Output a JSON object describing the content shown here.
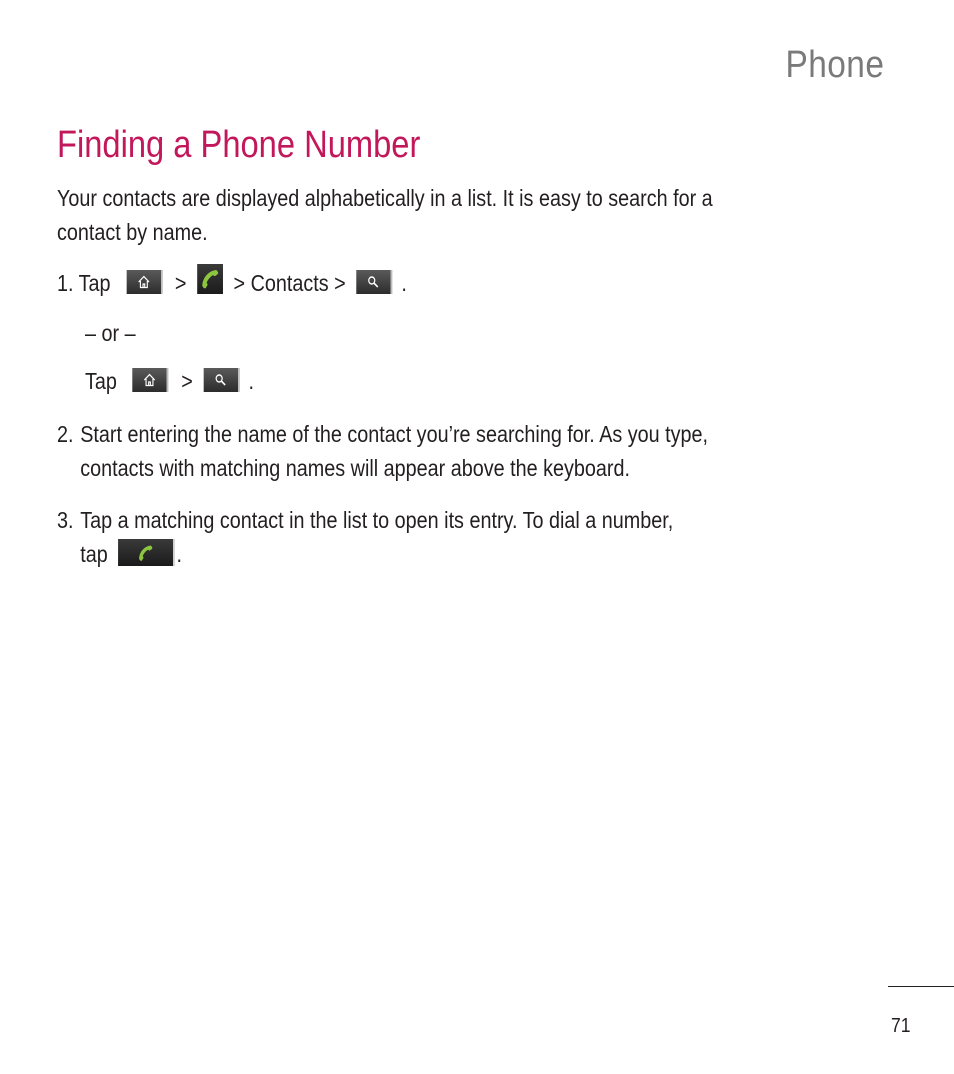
{
  "header": {
    "section": "Phone"
  },
  "title": "Finding a Phone Number",
  "intro": {
    "line1": "Your contacts are displayed alphabetically in a list. It is easy to search for a",
    "line2": "contact by name."
  },
  "steps": [
    {
      "number": "1.",
      "tap": "Tap",
      "separator": ">",
      "contacts": "Contacts",
      "end": ".",
      "icons": [
        "home-key-icon",
        "phone-app-icon",
        "search-key-icon"
      ],
      "or": "– or –",
      "alt_tap": "Tap",
      "alt_icons": [
        "home-key-icon",
        "search-key-icon"
      ]
    },
    {
      "number": "2.",
      "line1": "Start entering the name of the contact you’re searching for. As you type,",
      "line2": "contacts with matching names will appear above the keyboard."
    },
    {
      "number": "3.",
      "line1": "Tap a matching contact in the list to open its entry. To dial a number,",
      "line2": "tap",
      "end": ".",
      "icons": [
        "call-button-icon"
      ]
    }
  ],
  "colors": {
    "title": "#c2185b",
    "header": "#7a7a7a",
    "phone_green": "#8cc63f"
  },
  "footer": {
    "page_number": "71"
  }
}
